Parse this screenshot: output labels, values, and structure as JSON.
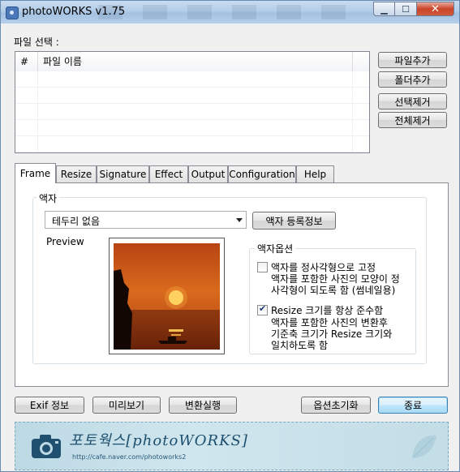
{
  "window": {
    "title": "photoWORKS v1.75"
  },
  "file_select": {
    "label": "파일 선택 :",
    "columns": [
      "#",
      "파일 이름"
    ],
    "buttons": {
      "add_file": "파일추가",
      "add_folder": "폴더추가",
      "remove_selected": "선택제거",
      "remove_all": "전체제거"
    }
  },
  "tabs": [
    "Frame",
    "Resize",
    "Signature",
    "Effect",
    "Output",
    "Configuration",
    "Help"
  ],
  "frame": {
    "group_title": "액자",
    "combo_value": "테두리 없음",
    "register_button": "액자 등록정보",
    "preview_label": "Preview",
    "options": {
      "title": "액자옵션",
      "square": {
        "label": "액자를 정사각형으로 고정",
        "checked": false,
        "desc": [
          "액자를 포함한 사진의 모양이 정",
          "사각형이 되도록 함 (썸네일용)"
        ]
      },
      "resize": {
        "label": "Resize 크기를 항상 준수함",
        "checked": true,
        "desc": [
          "액자를 포함한 사진의 변환후",
          "기준축 크기가 Resize 크기와",
          "일치하도록 함"
        ]
      }
    }
  },
  "bottom_buttons": {
    "exif": "Exif 정보",
    "preview": "미리보기",
    "convert": "변환실행",
    "reset": "옵션초기화",
    "exit": "종료"
  },
  "banner": {
    "title": "포토웍스[photoWORKS]",
    "url": "http://cafe.naver.com/photoworks2"
  }
}
